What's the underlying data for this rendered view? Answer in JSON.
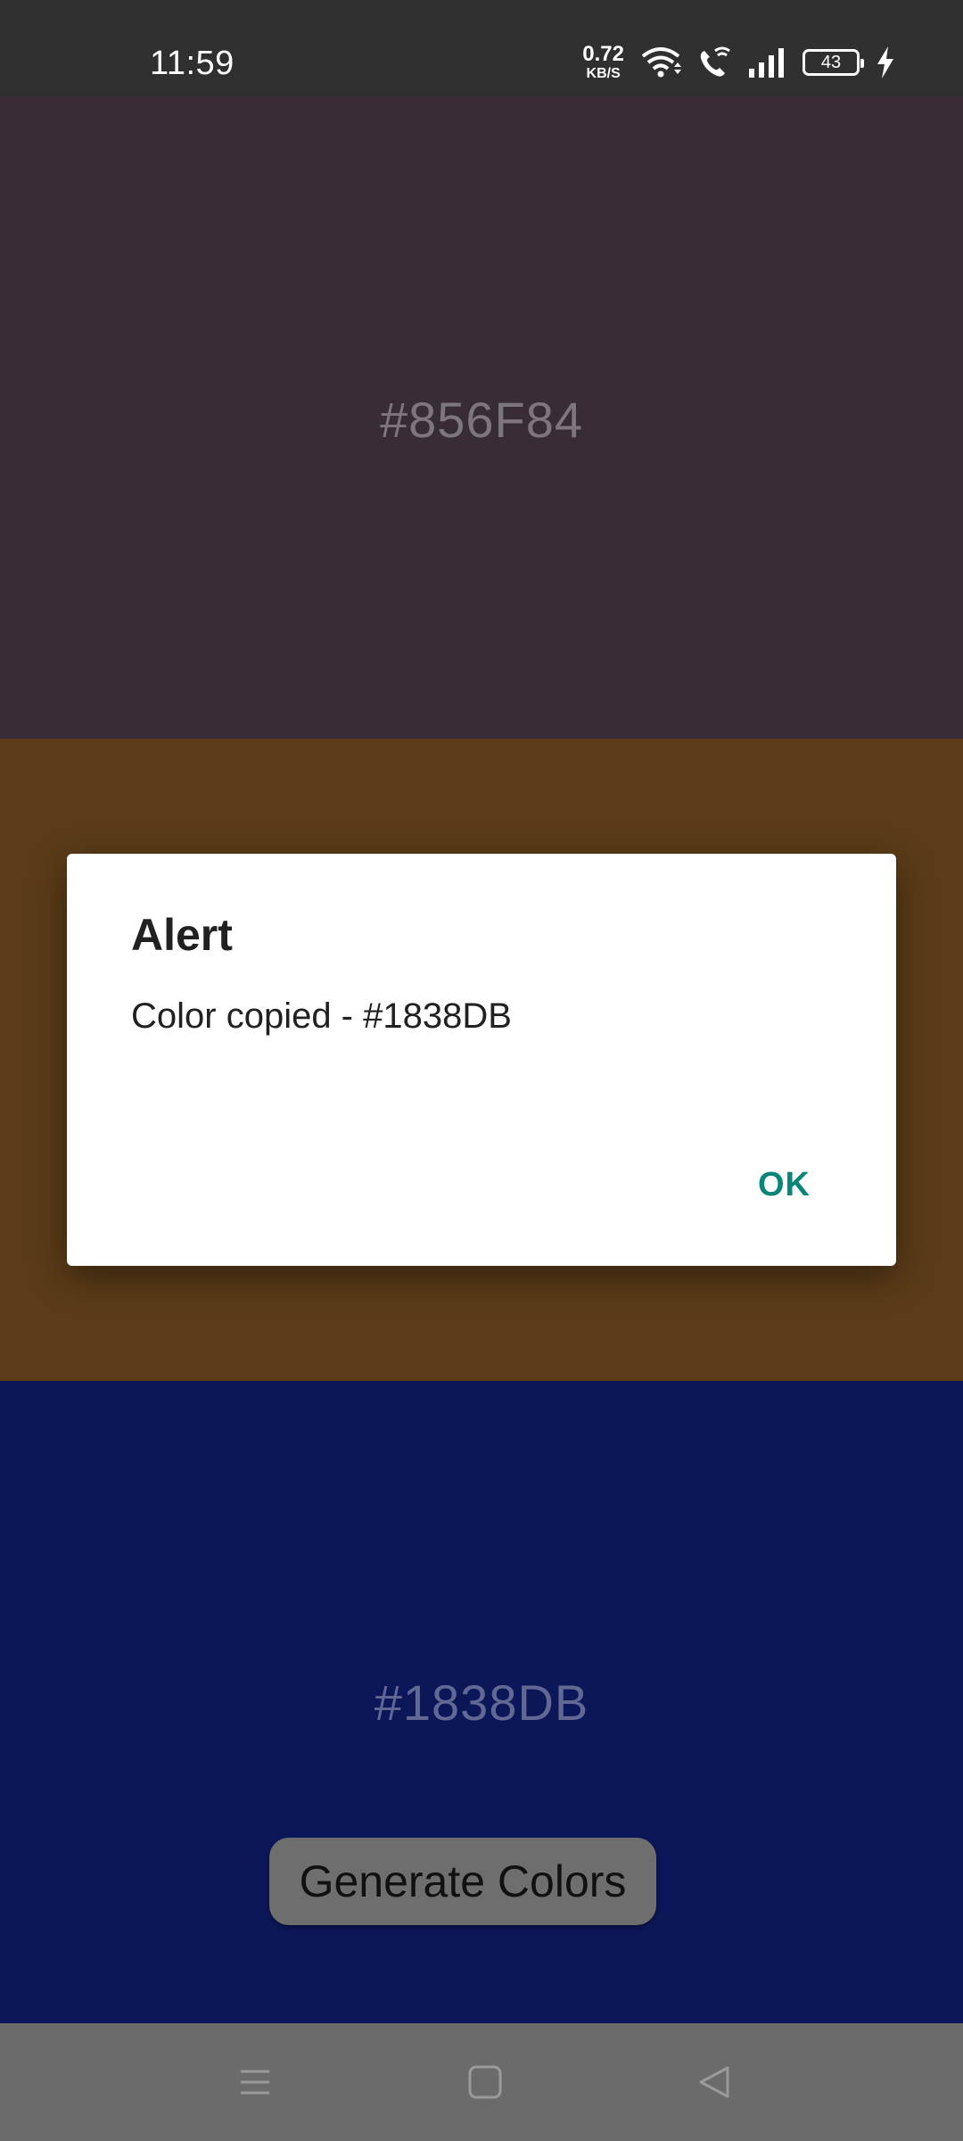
{
  "status_bar": {
    "time": "11:59",
    "net_speed_value": "0.72",
    "net_speed_unit": "KB/S",
    "battery_level": "43"
  },
  "panels": [
    {
      "hex": "#856F84",
      "background": "#382d37"
    },
    {
      "hex": "",
      "background": "#5c3c18"
    },
    {
      "hex": "#1838DB",
      "background": "#0c1759"
    }
  ],
  "generate_button": {
    "label": "Generate Colors"
  },
  "dialog": {
    "title": "Alert",
    "message": "Color copied - #1838DB",
    "ok_label": "OK",
    "ok_color": "#0a857a"
  },
  "nav_bar": {
    "icons": [
      "menu-icon",
      "home-square-icon",
      "back-triangle-icon"
    ]
  }
}
